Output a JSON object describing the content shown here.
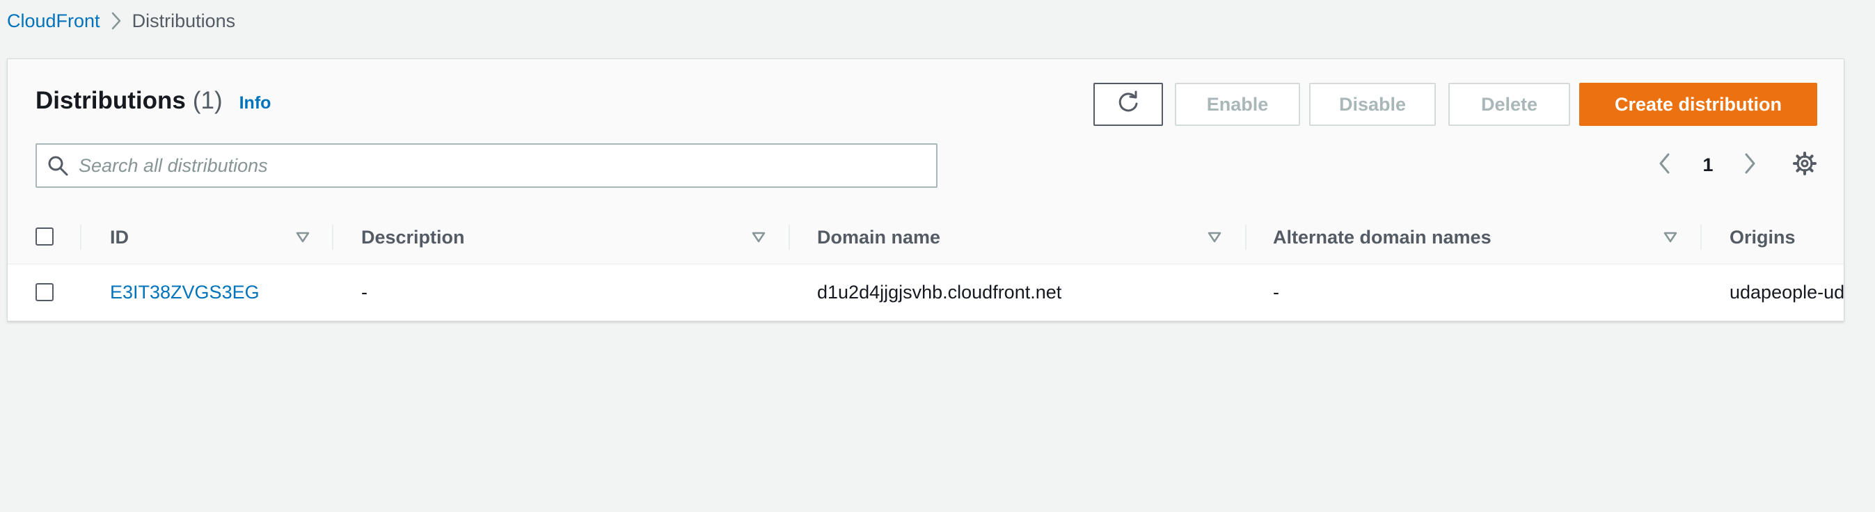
{
  "breadcrumb": {
    "root": "CloudFront",
    "current": "Distributions"
  },
  "header": {
    "title": "Distributions",
    "count": "(1)",
    "info": "Info"
  },
  "actions": {
    "enable": "Enable",
    "disable": "Disable",
    "delete": "Delete",
    "create": "Create distribution"
  },
  "search": {
    "placeholder": "Search all distributions",
    "value": ""
  },
  "pagination": {
    "current_page": "1"
  },
  "table": {
    "columns": [
      "ID",
      "Description",
      "Domain name",
      "Alternate domain names",
      "Origins"
    ],
    "rows": [
      {
        "id": "E3IT38ZVGS3EG",
        "description": "-",
        "domain_name": "d1u2d4jjgjsvhb.cloudfront.net",
        "alternate_domain_names": "-",
        "origins": "udapeople-ud"
      }
    ]
  },
  "colors": {
    "link": "#0073bb",
    "primary_button": "#ec7211",
    "page_background": "#f2f3f3",
    "disabled_text": "#aab7b8"
  },
  "icons": {
    "refresh": "refresh-icon",
    "search": "search-icon",
    "previous": "chevron-left-icon",
    "next": "chevron-right-icon",
    "settings": "gear-icon",
    "sort": "sort-triangle-icon",
    "breadcrumb_separator": "chevron-right-icon"
  }
}
